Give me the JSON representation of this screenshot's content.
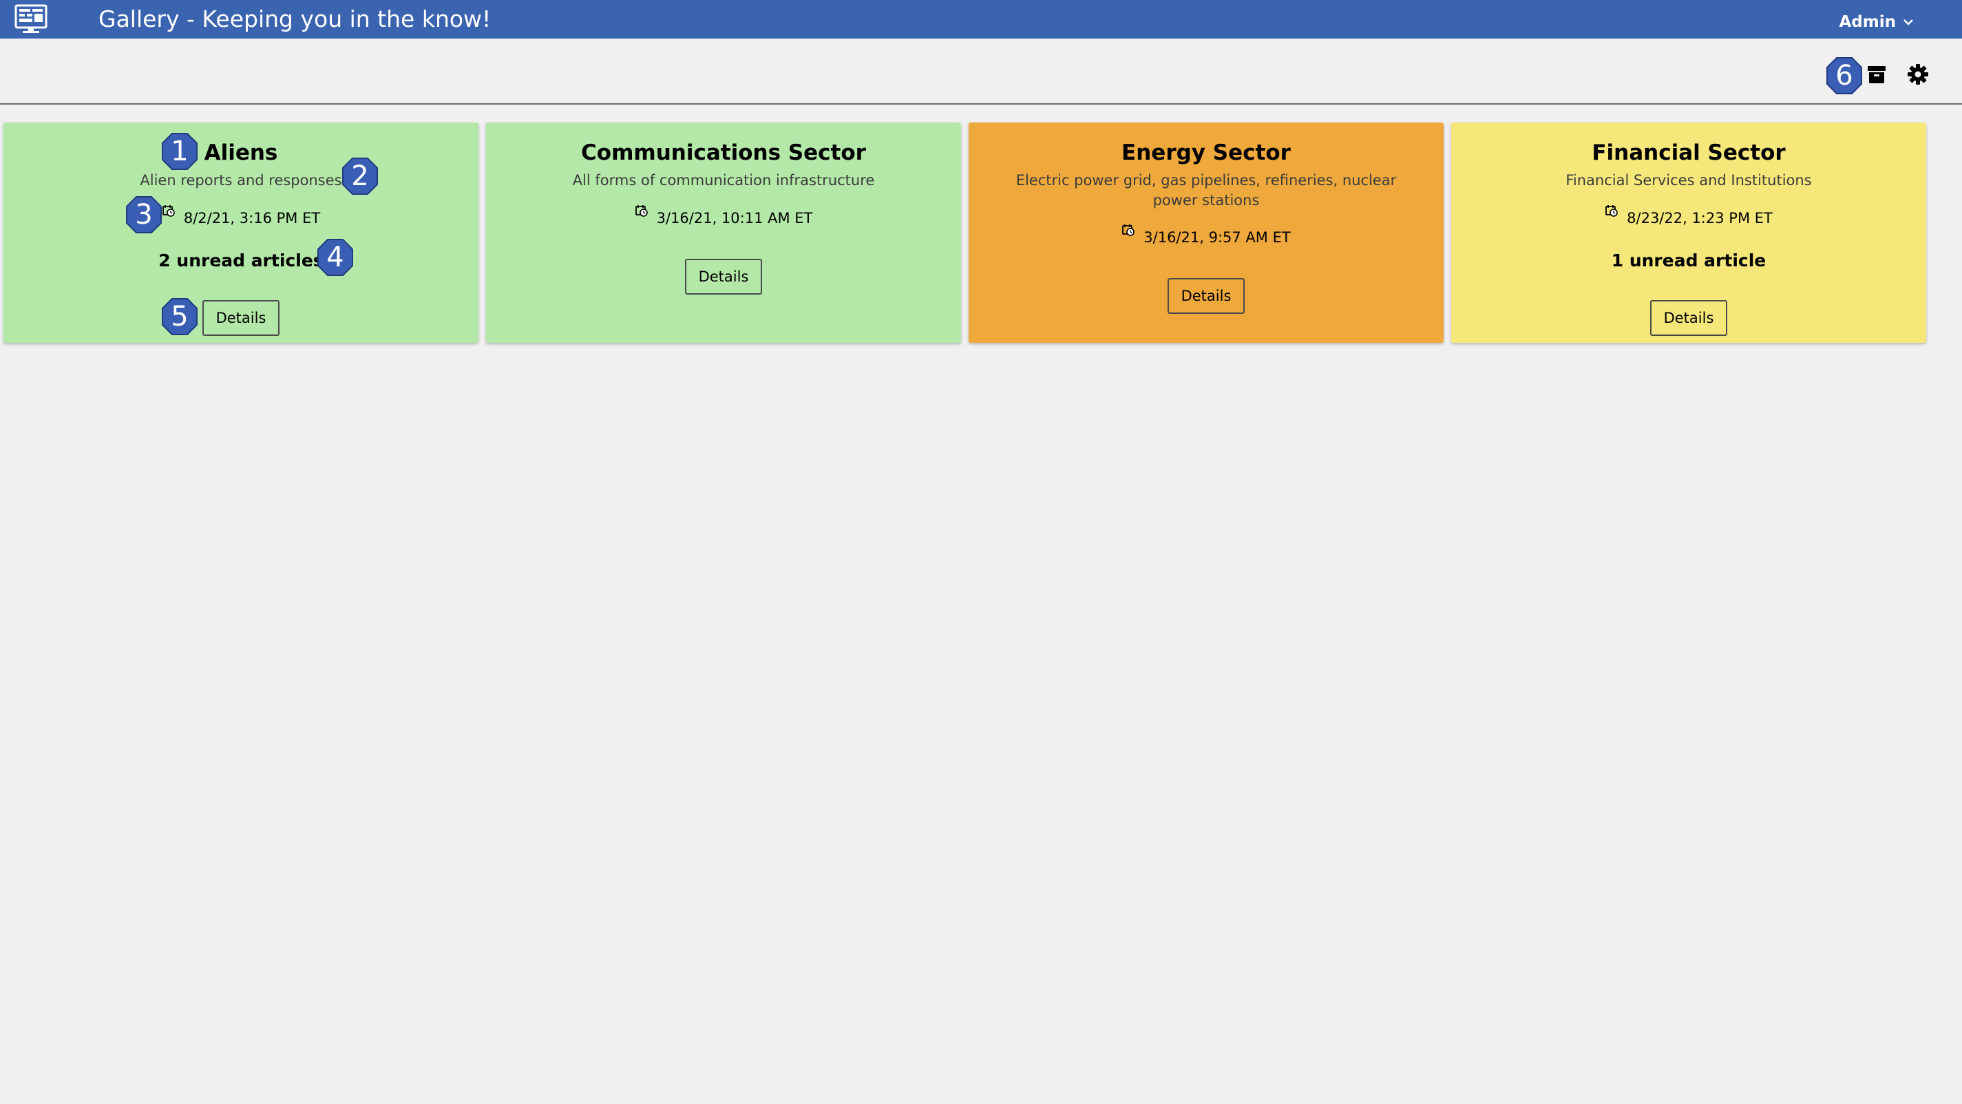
{
  "app": {
    "title": "Gallery - Keeping you in the know!",
    "user_label": "Admin",
    "bar_color": "#3a63b0"
  },
  "toolbar": {
    "archive_icon": "archive-icon",
    "settings_icon": "gear-icon"
  },
  "callouts": [
    "1",
    "2",
    "3",
    "4",
    "5",
    "6"
  ],
  "cards": [
    {
      "title": "Aliens",
      "description": "Alien reports and responses",
      "date": "8/2/21, 3:16 PM ET",
      "unread": "2 unread articles",
      "details_label": "Details",
      "color": "#b3e8a8"
    },
    {
      "title": "Communications Sector",
      "description": "All forms of communication infrastructure",
      "date": "3/16/21, 10:11 AM ET",
      "unread": "",
      "details_label": "Details",
      "color": "#b3e8a8"
    },
    {
      "title": "Energy Sector",
      "description": "Electric power grid, gas pipelines, refineries, nuclear power stations",
      "date": "3/16/21, 9:57 AM ET",
      "unread": "",
      "details_label": "Details",
      "color": "#eea83c"
    },
    {
      "title": "Financial Sector",
      "description": "Financial Services and Institutions",
      "date": "8/23/22, 1:23 PM ET",
      "unread": "1 unread article",
      "details_label": "Details",
      "color": "#f6e77a"
    }
  ]
}
